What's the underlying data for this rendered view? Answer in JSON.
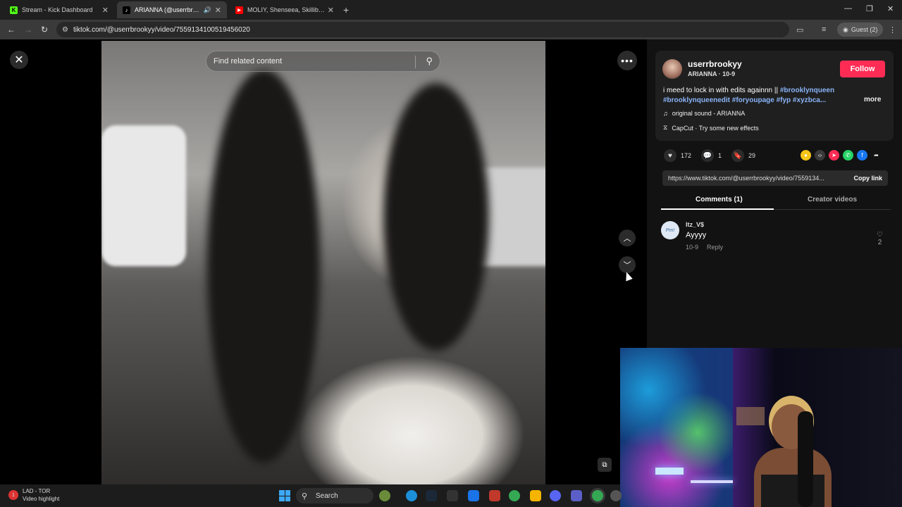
{
  "browser": {
    "tabs": [
      {
        "title": "Stream - Kick Dashboard",
        "active": false,
        "favicon_color": "#53fc18",
        "favicon_letter": "K"
      },
      {
        "title": "ARIANNA (@userrbrookyy)",
        "active": true,
        "favicon_color": "#000000",
        "favicon_letter": "♪"
      },
      {
        "title": "MOLIY, Shenseea, Skillibeng, Sa",
        "active": false,
        "favicon_color": "#ff0000",
        "favicon_letter": "▶"
      }
    ],
    "url": "tiktok.com/@userrbrookyy/video/7559134100519456020",
    "guest_label": "Guest (2)"
  },
  "video": {
    "search_placeholder": "Find related content"
  },
  "post": {
    "username": "userrbrookyy",
    "display_name": "ARIANNA",
    "date": "10-9",
    "follow_label": "Follow",
    "description_text": "i meed to lock in with edits againnn || ",
    "hashtags_line1": "#brooklynqueen",
    "hashtags_line2": "#brooklynqueenedit #foryoupage #fyp #xyzbca...",
    "more_label": "more",
    "sound": "original sound - ARIANNA",
    "capcut": "CapCut · Try some new effects",
    "likes": "172",
    "comments": "1",
    "saves": "29",
    "share_colors": [
      "#f5c518",
      "#3a3a3a",
      "#fe2c55",
      "#25d366",
      "#1877f2"
    ],
    "link": "https://www.tiktok.com/@userrbrookyy/video/7559134...",
    "copy_label": "Copy link"
  },
  "tabs": {
    "comments_label": "Comments (1)",
    "creator_label": "Creator videos"
  },
  "comment": {
    "author": "Itz_V$",
    "text": "Ayyyy",
    "date": "10-9",
    "reply_label": "Reply",
    "likes": "2",
    "avatar_text": "Pm!"
  },
  "taskbar": {
    "weather_title": "LAD - TOR",
    "weather_sub": "Video highlight",
    "badge": "1",
    "search_label": "Search"
  }
}
